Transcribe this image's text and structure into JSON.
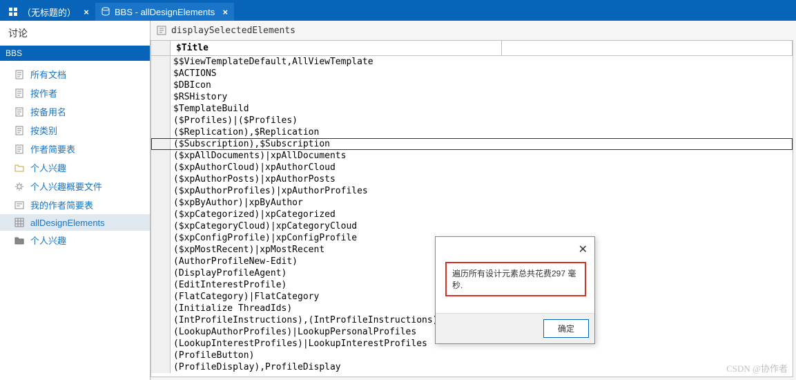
{
  "tabs": [
    {
      "label": "（无标题的）",
      "icon": "grid-icon"
    },
    {
      "label": "BBS - allDesignElements",
      "icon": "db-icon"
    }
  ],
  "sidebar": {
    "title": "讨论",
    "group": "BBS",
    "items": [
      {
        "label": "所有文档",
        "icon": "doc"
      },
      {
        "label": "按作者",
        "icon": "doc"
      },
      {
        "label": "按备用名",
        "icon": "doc"
      },
      {
        "label": "按类别",
        "icon": "doc"
      },
      {
        "label": "作者简要表",
        "icon": "doc"
      },
      {
        "label": "个人兴趣",
        "icon": "folder"
      },
      {
        "label": "个人兴趣概要文件",
        "icon": "gear"
      },
      {
        "label": "我的作者简要表",
        "icon": "link"
      },
      {
        "label": "allDesignElements",
        "icon": "grid",
        "selected": true
      },
      {
        "label": "个人兴趣",
        "icon": "folder-dark"
      }
    ]
  },
  "content": {
    "toolbar_label": "displaySelectedElements",
    "header_title": "$Title",
    "selected_index": 7,
    "rows": [
      "$$ViewTemplateDefault,AllViewTemplate",
      "$ACTIONS",
      "$DBIcon",
      "$RSHistory",
      "$TemplateBuild",
      "($Profiles)|($Profiles)",
      "($Replication),$Replication",
      "($Subscription),$Subscription",
      "($xpAllDocuments)|xpAllDocuments",
      "($xpAuthorCloud)|xpAuthorCloud",
      "($xpAuthorPosts)|xpAuthorPosts",
      "($xpAuthorProfiles)|xpAuthorProfiles",
      "($xpByAuthor)|xpByAuthor",
      "($xpCategorized)|xpCategorized",
      "($xpCategoryCloud)|xpCategoryCloud",
      "($xpConfigProfile)|xpConfigProfile",
      "($xpMostRecent)|xpMostRecent",
      "(AuthorProfileNew-Edit)",
      "(DisplayProfileAgent)",
      "(EditInterestProfile)",
      "(FlatCategory)|FlatCategory",
      "(Initialize ThreadIds)",
      "(IntProfileInstructions),(IntProfileInstructions)",
      "(LookupAuthorProfiles)|LookupPersonalProfiles",
      "(LookupInterestProfiles)|LookupInterestProfiles",
      "(ProfileButton)",
      "(ProfileDisplay),ProfileDisplay"
    ]
  },
  "dialog": {
    "message": "遍历所有设计元素总共花费297 毫秒.",
    "ok_label": "确定"
  },
  "watermark": "CSDN @协作者"
}
